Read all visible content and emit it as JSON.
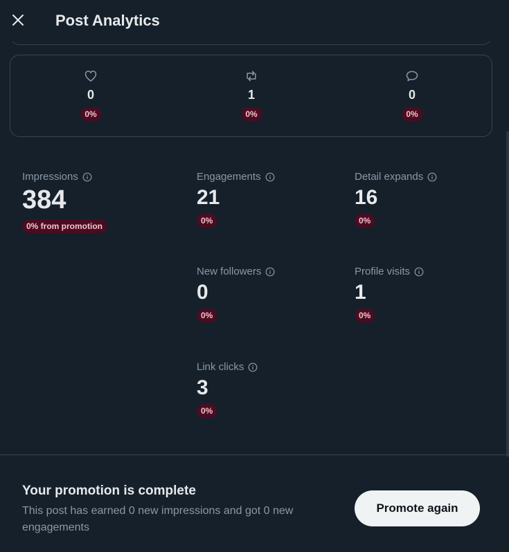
{
  "header": {
    "title": "Post Analytics",
    "close_icon": "close-icon"
  },
  "engagement_summary": [
    {
      "icon": "heart-icon",
      "value": "0",
      "badge": "0%"
    },
    {
      "icon": "repost-icon",
      "value": "1",
      "badge": "0%"
    },
    {
      "icon": "reply-icon",
      "value": "0",
      "badge": "0%"
    }
  ],
  "metrics": {
    "impressions": {
      "label": "Impressions",
      "value": "384",
      "badge": "0% from promotion"
    },
    "engagements": {
      "label": "Engagements",
      "value": "21",
      "badge": "0%"
    },
    "detail_expands": {
      "label": "Detail expands",
      "value": "16",
      "badge": "0%"
    },
    "new_followers": {
      "label": "New followers",
      "value": "0",
      "badge": "0%"
    },
    "profile_visits": {
      "label": "Profile visits",
      "value": "1",
      "badge": "0%"
    },
    "link_clicks": {
      "label": "Link clicks",
      "value": "3",
      "badge": "0%"
    }
  },
  "footer": {
    "title": "Your promotion is complete",
    "text": "This post has earned 0 new impressions and got 0 new engagements",
    "button_label": "Promote again"
  },
  "colors": {
    "background": "#15202b",
    "border": "#38444d",
    "badge_bg": "#4a0c20",
    "badge_text": "#f5c2cf",
    "secondary_text": "#8b98a5",
    "button_bg": "#eff3f4"
  }
}
